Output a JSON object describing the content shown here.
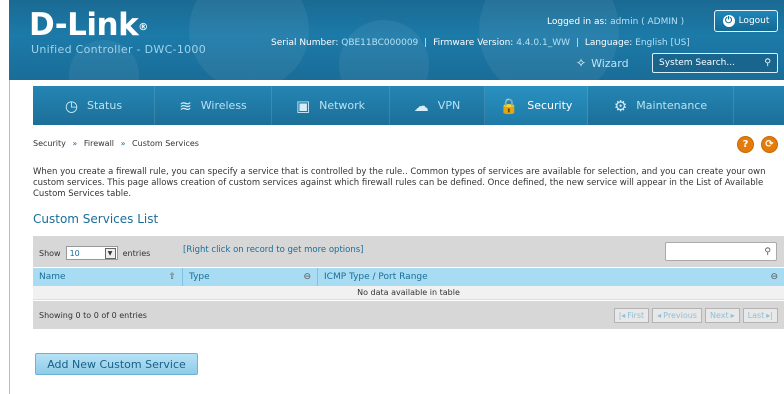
{
  "header": {
    "brand": "D-Link",
    "brand_mark": "®",
    "tagline": "Unified Controller - DWC-1000",
    "serial_label": "Serial Number:",
    "serial_value": "QBE11BC000009",
    "firmware_label": "Firmware Version:",
    "firmware_value": "4.4.0.1_WW",
    "language_label": "Language:",
    "language_value": "English [US]",
    "logged_in_label": "Logged in as:",
    "logged_in_value": "admin ( ADMIN )",
    "logout_label": "Logout",
    "wizard_label": "Wizard",
    "search_placeholder": "System Search..."
  },
  "nav": {
    "items": [
      {
        "label": "Status",
        "icon": "dashboard-icon",
        "glyph": "◷"
      },
      {
        "label": "Wireless",
        "icon": "wifi-icon",
        "glyph": "≋"
      },
      {
        "label": "Network",
        "icon": "monitor-icon",
        "glyph": "▣"
      },
      {
        "label": "VPN",
        "icon": "cloud-lock-icon",
        "glyph": "☁"
      },
      {
        "label": "Security",
        "icon": "lock-icon",
        "glyph": "🔒"
      },
      {
        "label": "Maintenance",
        "icon": "gears-icon",
        "glyph": "⚙"
      }
    ],
    "active": "Security"
  },
  "breadcrumb": {
    "items": [
      "Security",
      "Firewall",
      "Custom Services"
    ],
    "separator": "»"
  },
  "help": {
    "label": "?",
    "refresh_label": "⟳"
  },
  "description": "When you create a firewall rule, you can specify a service that is controlled by the rule.. Common types of services are available for selection, and you can create your own custom services. This page allows creation of custom services against which firewall rules can be defined. Once defined, the new service will appear in the List of Available Custom Services table.",
  "list_title": "Custom Services List",
  "table": {
    "show_label": "Show",
    "entries_value": "10",
    "entries_label": "entries",
    "hint": "[Right click on record to get more options]",
    "columns": [
      "Name",
      "Type",
      "ICMP Type / Port Range"
    ],
    "empty_message": "No data available in table",
    "info": "Showing 0 to 0 of 0 entries",
    "pager": {
      "first": "First",
      "previous": "Previous",
      "next": "Next",
      "last": "Last"
    }
  },
  "add_button_label": "Add New Custom Service",
  "colors": {
    "header_blue": "#1c7aa8",
    "accent": "#1a6d98",
    "table_header": "#a8dcf3",
    "help_orange": "#e37c0d"
  }
}
